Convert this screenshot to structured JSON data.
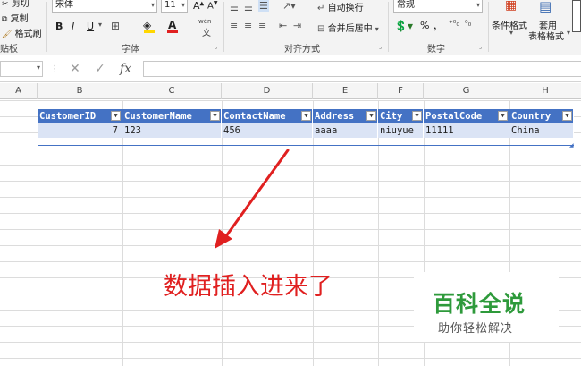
{
  "ribbon": {
    "clipboard": {
      "cut_label": "剪切",
      "copy_label": "复制",
      "format_painter_label": "格式刷",
      "group_label": "贴板"
    },
    "font": {
      "font_name": "宋体",
      "font_size": "11",
      "bold_label": "B",
      "italic_label": "I",
      "underline_label": "U",
      "font_color_label": "A",
      "phonetic_label": "wén",
      "group_label": "字体"
    },
    "alignment": {
      "wrap_text_label": "自动换行",
      "merge_center_label": "合并后居中",
      "group_label": "对齐方式"
    },
    "number": {
      "format_value": "常规",
      "percent_label": "%",
      "comma_label": "，",
      "group_label": "数字"
    },
    "styles": {
      "conditional_format_label": "条件格式",
      "format_as_table_line1": "套用",
      "format_as_table_line2": "表格格式"
    }
  },
  "formula_bar": {
    "name_box_value": "",
    "formula_value": ""
  },
  "columns": [
    "A",
    "B",
    "C",
    "D",
    "E",
    "F",
    "G",
    "H"
  ],
  "table": {
    "headers": [
      "CustomerID",
      "CustomerName",
      "ContactName",
      "Address",
      "City",
      "PostalCode",
      "Country"
    ],
    "rows": [
      [
        "7",
        "123",
        "456",
        "aaaa",
        "niuyue",
        "11111",
        "China"
      ]
    ],
    "header_color": "#4472c4",
    "band_color": "#dbe4f5"
  },
  "annotation": {
    "text": "数据插入进来了",
    "color": "#e02020"
  },
  "watermark": {
    "main_text": "百科全说",
    "sub_text": "助你轻松解决",
    "color": "#2e9a3b"
  }
}
